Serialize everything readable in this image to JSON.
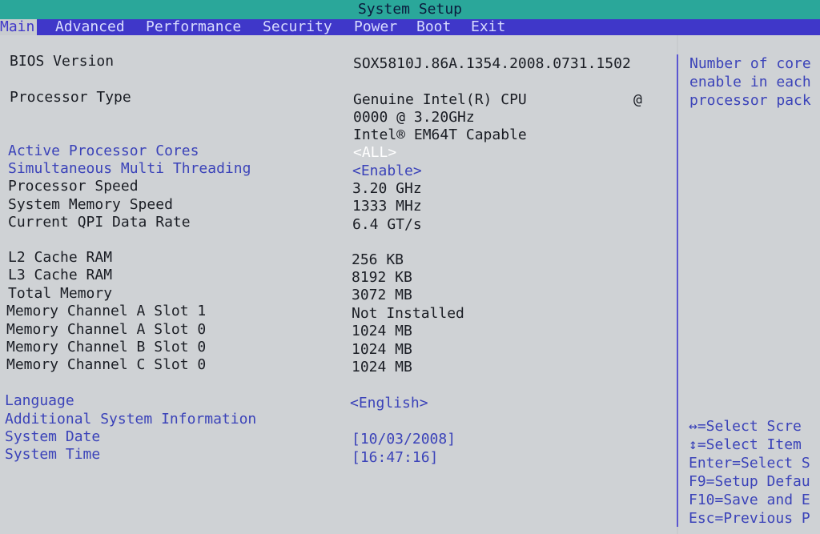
{
  "window": {
    "title": "System Setup"
  },
  "menu": [
    {
      "label": "Main",
      "active": true
    },
    {
      "label": "Advanced"
    },
    {
      "label": "Performance"
    },
    {
      "label": "Security"
    },
    {
      "label": "Power"
    },
    {
      "label": "Boot"
    },
    {
      "label": "Exit"
    }
  ],
  "main": {
    "bios_version": {
      "label": "BIOS Version",
      "value": "SOX5810J.86A.1354.2008.0731.1502"
    },
    "processor_type": {
      "label": "Processor Type",
      "value_line1": "Genuine Intel(R) CPU",
      "value_line1_suffix": "@",
      "value_line2": "0000 @ 3.20GHz",
      "value_line3": "Intel® EM64T Capable"
    },
    "active_cores": {
      "label": "Active Processor Cores",
      "value": "<ALL>"
    },
    "smt": {
      "label": "Simultaneous Multi Threading",
      "value": "<Enable>"
    },
    "processor_speed": {
      "label": "Processor Speed",
      "value": "3.20 GHz"
    },
    "memory_speed": {
      "label": "System Memory Speed",
      "value": "1333 MHz"
    },
    "qpi_rate": {
      "label": "Current QPI Data Rate",
      "value": "6.4 GT/s"
    },
    "l2_cache": {
      "label": "L2 Cache RAM",
      "value": "256 KB"
    },
    "l3_cache": {
      "label": "L3 Cache RAM",
      "value": "8192 KB"
    },
    "total_memory": {
      "label": "Total Memory",
      "value": "3072 MB"
    },
    "mem_a1": {
      "label": "Memory Channel A Slot 1",
      "value": "Not Installed"
    },
    "mem_a0": {
      "label": "Memory Channel A Slot 0",
      "value": "1024 MB"
    },
    "mem_b0": {
      "label": "Memory Channel B Slot 0",
      "value": "1024 MB"
    },
    "mem_c0": {
      "label": "Memory Channel C Slot 0",
      "value": "1024 MB"
    },
    "language": {
      "label": "Language",
      "value": "<English>"
    },
    "additional_info": {
      "label": "Additional System Information"
    },
    "system_date": {
      "label": "System Date",
      "value": "[10/03/2008]"
    },
    "system_time": {
      "label": "System Time",
      "value": "[16:47:16]"
    }
  },
  "help": {
    "lines": [
      "Number of core",
      "enable in each",
      "processor pack"
    ]
  },
  "keys": {
    "lines": [
      "↔=Select Scre",
      "↕=Select Item",
      "Enter=Select S",
      "F9=Setup Defau",
      "F10=Save and E",
      "Esc=Previous P"
    ]
  }
}
